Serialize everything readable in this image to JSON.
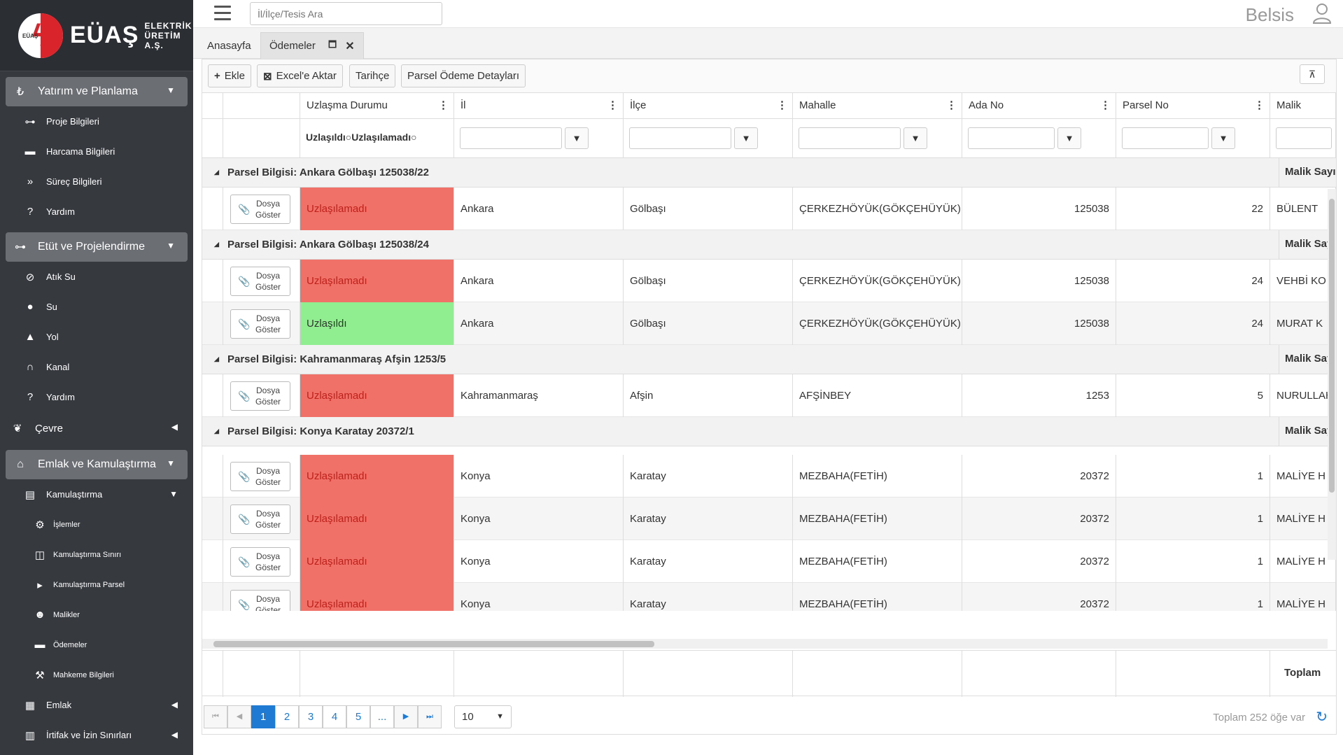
{
  "brand": {
    "name": "EÜAŞ",
    "sub1": "ELEKTRİK",
    "sub2": "ÜRETİM A.Ş.",
    "mark": "EÜAŞ"
  },
  "sidebar": {
    "sec1": {
      "label": "Yatırım ve Planlama"
    },
    "sec1_items": [
      {
        "label": "Proje Bilgileri"
      },
      {
        "label": "Harcama Bilgileri"
      },
      {
        "label": "Süreç Bilgileri"
      },
      {
        "label": "Yardım"
      }
    ],
    "sec2": {
      "label": "Etüt ve Projelendirme"
    },
    "sec2_items": [
      {
        "label": "Atık Su"
      },
      {
        "label": "Su"
      },
      {
        "label": "Yol"
      },
      {
        "label": "Kanal"
      },
      {
        "label": "Yardım"
      }
    ],
    "cevre": {
      "label": "Çevre"
    },
    "sec3": {
      "label": "Emlak ve Kamulaştırma"
    },
    "kamulastirma": {
      "label": "Kamulaştırma"
    },
    "kam_items": [
      {
        "label": "İşlemler"
      },
      {
        "label": "Kamulaştırma Sınırı"
      },
      {
        "label": "Kamulaştırma Parsel"
      },
      {
        "label": "Malikler"
      },
      {
        "label": "Ödemeler"
      },
      {
        "label": "Mahkeme Bilgileri"
      }
    ],
    "emlak": {
      "label": "Emlak"
    },
    "irtifak": {
      "label": "İrtifak ve İzin Sınırları"
    }
  },
  "topbar": {
    "search_placeholder": "İl/İlçe/Tesis Ara",
    "user": "Belsis"
  },
  "tabs": [
    {
      "label": "Anasayfa"
    },
    {
      "label": "Ödemeler"
    }
  ],
  "toolbar": {
    "add": "Ekle",
    "excel": "Excel'e Aktar",
    "history": "Tarihçe",
    "details": "Parsel Ödeme Detayları"
  },
  "columns": {
    "uzlasma": "Uzlaşma Durumu",
    "il": "İl",
    "ilce": "İlçe",
    "mahalle": "Mahalle",
    "ada": "Ada No",
    "parsel": "Parsel No",
    "malik": "Malik"
  },
  "filter": {
    "opt1": "Uzlaşıldı",
    "opt2": "Uzlaşılamadı"
  },
  "dosya_label": {
    "line1": "Dosya",
    "line2": "Göster"
  },
  "groups": [
    {
      "title": "Parsel Bilgisi: Ankara Gölbaşı 125038/22",
      "malik": "Malik Sayısı",
      "rows": [
        {
          "status": "Uzlaşılamadı",
          "ok": false,
          "il": "Ankara",
          "ilce": "Gölbaşı",
          "mahalle": "ÇERKEZHÖYÜK(GÖKÇEHÜYÜK)",
          "ada": "125038",
          "parsel": "22",
          "malik": "BÜLENT"
        }
      ]
    },
    {
      "title": "Parsel Bilgisi: Ankara Gölbaşı 125038/24",
      "malik": "Malik Sayısı",
      "rows": [
        {
          "status": "Uzlaşılamadı",
          "ok": false,
          "il": "Ankara",
          "ilce": "Gölbaşı",
          "mahalle": "ÇERKEZHÖYÜK(GÖKÇEHÜYÜK)",
          "ada": "125038",
          "parsel": "24",
          "malik": "VEHBİ KO"
        },
        {
          "status": "Uzlaşıldı",
          "ok": true,
          "il": "Ankara",
          "ilce": "Gölbaşı",
          "mahalle": "ÇERKEZHÖYÜK(GÖKÇEHÜYÜK)",
          "ada": "125038",
          "parsel": "24",
          "malik": "MURAT K"
        }
      ]
    },
    {
      "title": "Parsel Bilgisi: Kahramanmaraş Afşin 1253/5",
      "malik": "Malik Sayısı",
      "rows": [
        {
          "status": "Uzlaşılamadı",
          "ok": false,
          "il": "Kahramanmaraş",
          "ilce": "Afşin",
          "mahalle": "AFŞİNBEY",
          "ada": "1253",
          "parsel": "5",
          "malik": "NURULLAH"
        }
      ]
    },
    {
      "title": "Parsel Bilgisi: Konya Karatay 20372/1",
      "malik": "Malik Sayısı",
      "rows": [
        {
          "status": "Uzlaşılamadı",
          "ok": false,
          "il": "Konya",
          "ilce": "Karatay",
          "mahalle": "MEZBAHA(FETİH)",
          "ada": "20372",
          "parsel": "1",
          "malik": "MALİYE H"
        },
        {
          "status": "Uzlaşılamadı",
          "ok": false,
          "il": "Konya",
          "ilce": "Karatay",
          "mahalle": "MEZBAHA(FETİH)",
          "ada": "20372",
          "parsel": "1",
          "malik": "MALİYE H"
        },
        {
          "status": "Uzlaşılamadı",
          "ok": false,
          "il": "Konya",
          "ilce": "Karatay",
          "mahalle": "MEZBAHA(FETİH)",
          "ada": "20372",
          "parsel": "1",
          "malik": "MALİYE H"
        },
        {
          "status": "Uzlaşılamadı",
          "ok": false,
          "il": "Konya",
          "ilce": "Karatay",
          "mahalle": "MEZBAHA(FETİH)",
          "ada": "20372",
          "parsel": "1",
          "malik": "MALİYE H"
        }
      ]
    }
  ],
  "footer": {
    "total_label": "Toplam"
  },
  "pager": {
    "pages": [
      "1",
      "2",
      "3",
      "4",
      "5",
      "..."
    ],
    "page_size": "10",
    "info": "Toplam 252 öğe var"
  }
}
